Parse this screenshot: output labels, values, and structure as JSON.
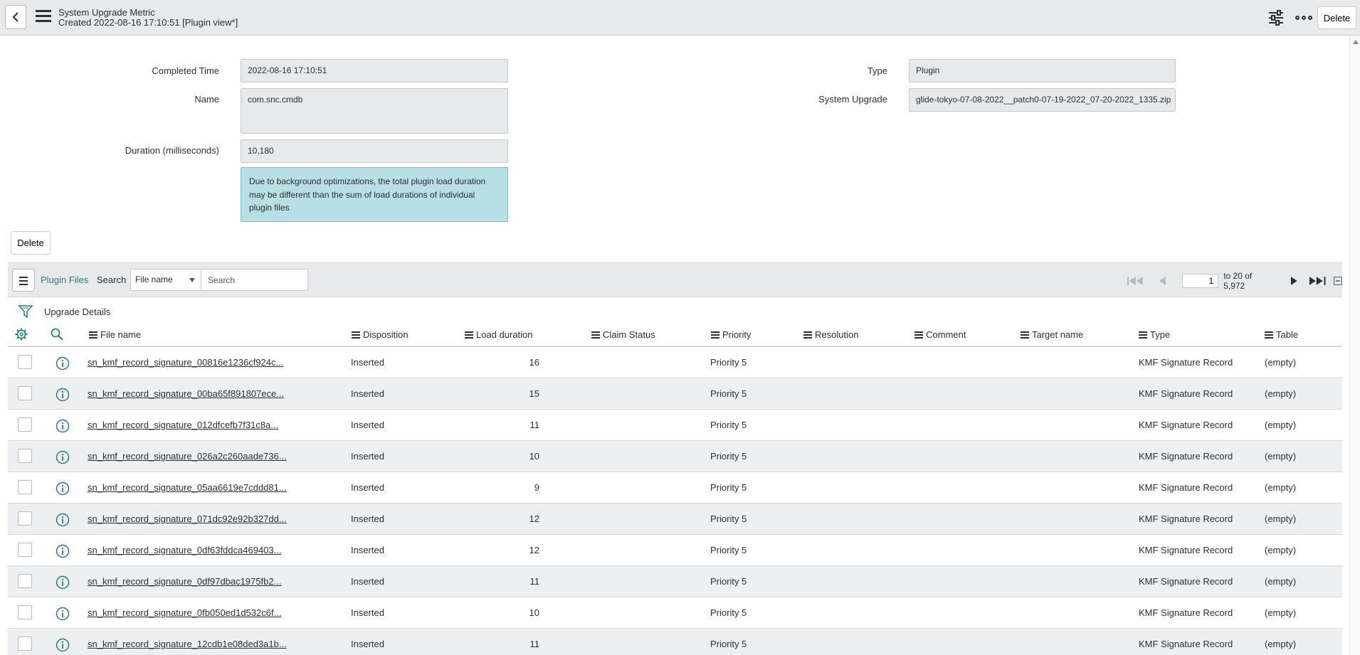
{
  "header": {
    "title": "System Upgrade Metric",
    "subtitle": "Created 2022-08-16 17:10:51 [Plugin view*]",
    "delete_label": "Delete"
  },
  "form": {
    "completed_time_label": "Completed Time",
    "completed_time_value": "2022-08-16 17:10:51",
    "name_label": "Name",
    "name_value": "com.snc.cmdb",
    "duration_label": "Duration (milliseconds)",
    "duration_value": "10,180",
    "info_message": "Due to background optimizations, the total plugin load duration may be different than the sum of load durations of individual plugin files",
    "type_label": "Type",
    "type_value": "Plugin",
    "system_upgrade_label": "System Upgrade",
    "system_upgrade_value": "glide-tokyo-07-08-2022__patch0-07-19-2022_07-20-2022_1335.zip",
    "delete_label": "Delete"
  },
  "list": {
    "title": "Plugin Files",
    "search_label": "Search",
    "search_field": "File name",
    "search_placeholder": "Search",
    "page_value": "1",
    "page_range": "to 20 of 5,972",
    "breadcrumb": "Upgrade Details",
    "columns": [
      "File name",
      "Disposition",
      "Load duration",
      "Claim Status",
      "Priority",
      "Resolution",
      "Comment",
      "Target name",
      "Type",
      "Table"
    ],
    "rows": [
      {
        "file": "sn_kmf_record_signature_00816e1236cf924c...",
        "disposition": "Inserted",
        "load": "16",
        "claim": "",
        "priority": "Priority 5",
        "resolution": "",
        "comment": "",
        "target": "",
        "type": "KMF Signature Record",
        "table": "(empty)"
      },
      {
        "file": "sn_kmf_record_signature_00ba65f891807ece...",
        "disposition": "Inserted",
        "load": "15",
        "claim": "",
        "priority": "Priority 5",
        "resolution": "",
        "comment": "",
        "target": "",
        "type": "KMF Signature Record",
        "table": "(empty)"
      },
      {
        "file": "sn_kmf_record_signature_012dfcefb7f31c8a...",
        "disposition": "Inserted",
        "load": "11",
        "claim": "",
        "priority": "Priority 5",
        "resolution": "",
        "comment": "",
        "target": "",
        "type": "KMF Signature Record",
        "table": "(empty)"
      },
      {
        "file": "sn_kmf_record_signature_026a2c260aade736...",
        "disposition": "Inserted",
        "load": "10",
        "claim": "",
        "priority": "Priority 5",
        "resolution": "",
        "comment": "",
        "target": "",
        "type": "KMF Signature Record",
        "table": "(empty)"
      },
      {
        "file": "sn_kmf_record_signature_05aa6619e7cddd81...",
        "disposition": "Inserted",
        "load": "9",
        "claim": "",
        "priority": "Priority 5",
        "resolution": "",
        "comment": "",
        "target": "",
        "type": "KMF Signature Record",
        "table": "(empty)"
      },
      {
        "file": "sn_kmf_record_signature_071dc92e92b327dd...",
        "disposition": "Inserted",
        "load": "12",
        "claim": "",
        "priority": "Priority 5",
        "resolution": "",
        "comment": "",
        "target": "",
        "type": "KMF Signature Record",
        "table": "(empty)"
      },
      {
        "file": "sn_kmf_record_signature_0df63fddca469403...",
        "disposition": "Inserted",
        "load": "12",
        "claim": "",
        "priority": "Priority 5",
        "resolution": "",
        "comment": "",
        "target": "",
        "type": "KMF Signature Record",
        "table": "(empty)"
      },
      {
        "file": "sn_kmf_record_signature_0df97dbac1975fb2...",
        "disposition": "Inserted",
        "load": "11",
        "claim": "",
        "priority": "Priority 5",
        "resolution": "",
        "comment": "",
        "target": "",
        "type": "KMF Signature Record",
        "table": "(empty)"
      },
      {
        "file": "sn_kmf_record_signature_0fb050ed1d532c6f...",
        "disposition": "Inserted",
        "load": "10",
        "claim": "",
        "priority": "Priority 5",
        "resolution": "",
        "comment": "",
        "target": "",
        "type": "KMF Signature Record",
        "table": "(empty)"
      },
      {
        "file": "sn_kmf_record_signature_12cdb1e08ded3a1b...",
        "disposition": "Inserted",
        "load": "11",
        "claim": "",
        "priority": "Priority 5",
        "resolution": "",
        "comment": "",
        "target": "",
        "type": "KMF Signature Record",
        "table": "(empty)"
      }
    ]
  },
  "colors": {
    "accent": "#1f8476",
    "header_bg": "#e7e9eb",
    "info_bg": "#b7dfe6"
  },
  "icons": [
    "back-arrow-icon",
    "hamburger-menu-icon",
    "sliders-icon",
    "more-options-icon",
    "funnel-filter-icon",
    "gear-icon",
    "magnifier-icon",
    "info-circle-icon",
    "first-page-icon",
    "previous-page-icon",
    "next-page-icon",
    "last-page-icon",
    "collapse-icon"
  ]
}
